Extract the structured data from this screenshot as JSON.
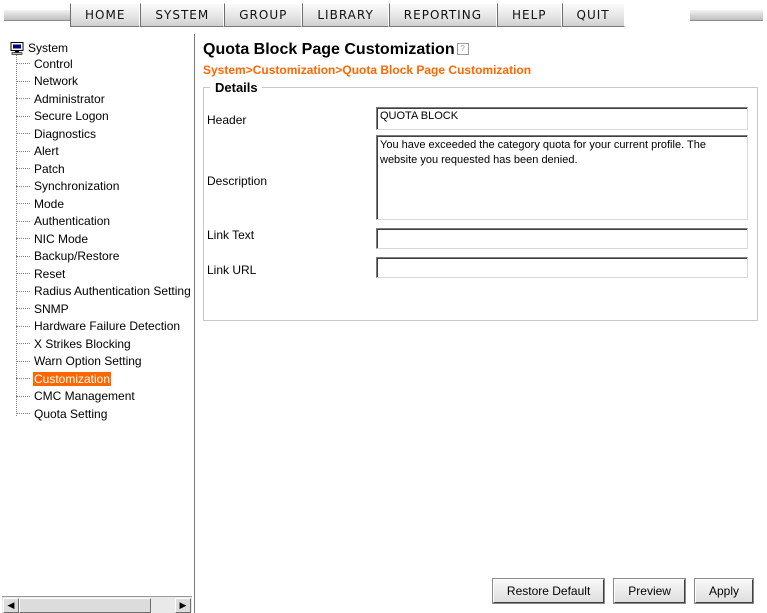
{
  "menu": {
    "items": [
      "HOME",
      "SYSTEM",
      "GROUP",
      "LIBRARY",
      "REPORTING",
      "HELP",
      "QUIT"
    ]
  },
  "tree": {
    "root_label": "System",
    "selected": "Customization",
    "items": [
      "Control",
      "Network",
      "Administrator",
      "Secure Logon",
      "Diagnostics",
      "Alert",
      "Patch",
      "Synchronization",
      "Mode",
      "Authentication",
      "NIC Mode",
      "Backup/Restore",
      "Reset",
      "Radius Authentication Setting",
      "SNMP",
      "Hardware Failure Detection",
      "X Strikes Blocking",
      "Warn Option Setting",
      "Customization",
      "CMC Management",
      "Quota Setting"
    ]
  },
  "page": {
    "title": "Quota Block Page Customization",
    "breadcrumb": "System>Customization>Quota Block Page Customization"
  },
  "details": {
    "legend": "Details",
    "header_label": "Header",
    "header_value": "QUOTA BLOCK",
    "description_label": "Description",
    "description_value": "You have exceeded the category quota for your current profile. The website you requested has been denied.",
    "link_text_label": "Link Text",
    "link_text_value": "",
    "link_url_label": "Link URL",
    "link_url_value": ""
  },
  "buttons": {
    "restore_default": "Restore Default",
    "preview": "Preview",
    "apply": "Apply"
  },
  "colors": {
    "accent": "#ff6600",
    "selected_bg": "#ff6600"
  },
  "icons": {
    "root": "computer-icon",
    "help": "help-icon"
  }
}
